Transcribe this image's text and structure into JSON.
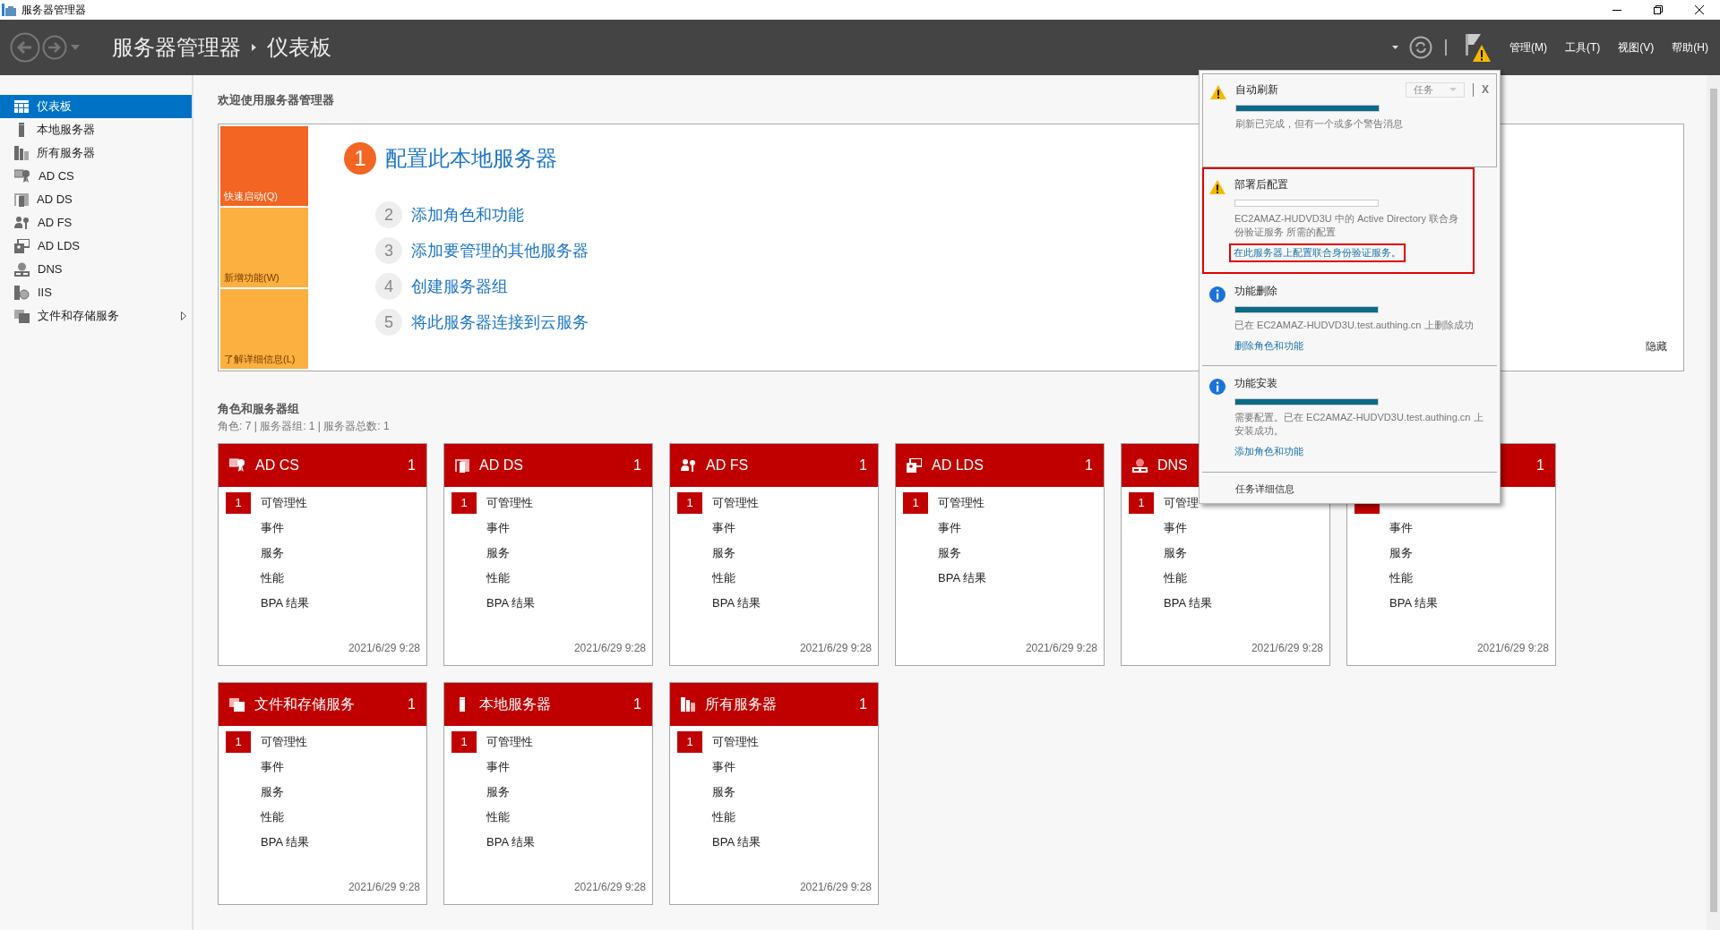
{
  "window": {
    "title": "服务器管理器"
  },
  "header": {
    "breadcrumb": [
      "服务器管理器",
      "仪表板"
    ],
    "menus": [
      "管理(M)",
      "工具(T)",
      "视图(V)",
      "帮助(H)"
    ],
    "flag_warning": true
  },
  "sidebar": {
    "items": [
      {
        "kind": "dashboard",
        "label": "仪表板",
        "selected": true,
        "has_children": false
      },
      {
        "kind": "local",
        "label": "本地服务器",
        "selected": false,
        "has_children": false
      },
      {
        "kind": "all",
        "label": "所有服务器",
        "selected": false,
        "has_children": false
      },
      {
        "kind": "adcs",
        "label": "AD CS",
        "selected": false,
        "has_children": false
      },
      {
        "kind": "adds",
        "label": "AD DS",
        "selected": false,
        "has_children": false
      },
      {
        "kind": "adfs",
        "label": "AD FS",
        "selected": false,
        "has_children": false
      },
      {
        "kind": "adlds",
        "label": "AD LDS",
        "selected": false,
        "has_children": false
      },
      {
        "kind": "dns",
        "label": "DNS",
        "selected": false,
        "has_children": false
      },
      {
        "kind": "iis",
        "label": "IIS",
        "selected": false,
        "has_children": false
      },
      {
        "kind": "files",
        "label": "文件和存储服务",
        "selected": false,
        "has_children": true
      }
    ]
  },
  "welcome": {
    "title": "欢迎使用服务器管理器",
    "quick_tiles": [
      {
        "label": "快速启动(Q)",
        "selected": true
      },
      {
        "label": "新增功能(W)",
        "selected": false
      },
      {
        "label": "了解详细信息(L)",
        "selected": false
      }
    ],
    "steps": [
      {
        "number": "1",
        "label": "配置此本地服务器",
        "primary": true
      },
      {
        "number": "2",
        "label": "添加角色和功能",
        "primary": false
      },
      {
        "number": "3",
        "label": "添加要管理的其他服务器",
        "primary": false
      },
      {
        "number": "4",
        "label": "创建服务器组",
        "primary": false
      },
      {
        "number": "5",
        "label": "将此服务器连接到云服务",
        "primary": false
      }
    ],
    "hide": "隐藏"
  },
  "roles": {
    "title": "角色和服务器组",
    "summary": "角色: 7 | 服务器组: 1 | 服务器总数: 1",
    "tiles": [
      {
        "kind": "adcs",
        "title": "AD CS",
        "count": "1",
        "rows": [
          {
            "label": "可管理性",
            "alert": true,
            "badge": "1"
          },
          {
            "label": "事件",
            "alert": false
          },
          {
            "label": "服务",
            "alert": false
          },
          {
            "label": "性能",
            "alert": false
          },
          {
            "label": "BPA 结果",
            "alert": false
          }
        ],
        "timestamp": "2021/6/29 9:28"
      },
      {
        "kind": "adds",
        "title": "AD DS",
        "count": "1",
        "rows": [
          {
            "label": "可管理性",
            "alert": true,
            "badge": "1"
          },
          {
            "label": "事件",
            "alert": false
          },
          {
            "label": "服务",
            "alert": false
          },
          {
            "label": "性能",
            "alert": false
          },
          {
            "label": "BPA 结果",
            "alert": false
          }
        ],
        "timestamp": "2021/6/29 9:28"
      },
      {
        "kind": "adfs",
        "title": "AD FS",
        "count": "1",
        "rows": [
          {
            "label": "可管理性",
            "alert": true,
            "badge": "1"
          },
          {
            "label": "事件",
            "alert": false
          },
          {
            "label": "服务",
            "alert": false
          },
          {
            "label": "性能",
            "alert": false
          },
          {
            "label": "BPA 结果",
            "alert": false
          }
        ],
        "timestamp": "2021/6/29 9:28"
      },
      {
        "kind": "adlds",
        "title": "AD LDS",
        "count": "1",
        "rows": [
          {
            "label": "可管理性",
            "alert": true,
            "badge": "1"
          },
          {
            "label": "事件",
            "alert": false
          },
          {
            "label": "服务",
            "alert": false
          },
          {
            "label": "BPA 结果",
            "alert": false
          }
        ],
        "timestamp": "2021/6/29 9:28"
      },
      {
        "kind": "dns",
        "title": "DNS",
        "rows": [
          {
            "label": "可管理",
            "alert": true,
            "badge": "1"
          },
          {
            "label": "事件",
            "alert": false
          },
          {
            "label": "服务",
            "alert": false
          },
          {
            "label": "性能",
            "alert": false
          },
          {
            "label": "BPA 结果",
            "alert": false
          }
        ],
        "timestamp": "2021/6/29 9:28"
      },
      {
        "kind": "hidden",
        "count": "1",
        "rows": [
          {
            "alert": true
          },
          {
            "label": "事件",
            "alert": false
          },
          {
            "label": "服务",
            "alert": false
          },
          {
            "label": "性能",
            "alert": false
          },
          {
            "label": "BPA 结果",
            "alert": false
          }
        ],
        "timestamp": "2021/6/29 9:28"
      },
      {
        "kind": "files",
        "title": "文件和存储服务",
        "count": "1",
        "rows": [
          {
            "label": "可管理性",
            "alert": true,
            "badge": "1"
          },
          {
            "label": "事件",
            "alert": false
          },
          {
            "label": "服务",
            "alert": false
          },
          {
            "label": "性能",
            "alert": false
          },
          {
            "label": "BPA 结果",
            "alert": false
          }
        ],
        "timestamp": "2021/6/29 9:28"
      },
      {
        "kind": "local",
        "title": "本地服务器",
        "count": "1",
        "rows": [
          {
            "label": "可管理性",
            "alert": true,
            "badge": "1"
          },
          {
            "label": "事件",
            "alert": false
          },
          {
            "label": "服务",
            "alert": false
          },
          {
            "label": "性能",
            "alert": false
          },
          {
            "label": "BPA 结果",
            "alert": false
          }
        ],
        "timestamp": "2021/6/29 9:28"
      },
      {
        "kind": "all",
        "title": "所有服务器",
        "count": "1",
        "rows": [
          {
            "label": "可管理性",
            "alert": true,
            "badge": "1"
          },
          {
            "label": "事件",
            "alert": false
          },
          {
            "label": "服务",
            "alert": false
          },
          {
            "label": "性能",
            "alert": false
          },
          {
            "label": "BPA 结果",
            "alert": false
          }
        ],
        "timestamp": "2021/6/29 9:28"
      }
    ]
  },
  "notifications": {
    "task_button": "任务",
    "close": "X",
    "items": [
      {
        "kind": "warning",
        "title": "自动刷新",
        "level": 1,
        "message": "刷新已完成，但有一个或多个警告消息",
        "selected": true,
        "highlighted": false
      },
      {
        "kind": "warning",
        "title": "部署后配置",
        "level": 0,
        "message": "EC2AMAZ-HUDVD3U 中的 Active Directory 联合身份验证服务 所需的配置",
        "link": "在此服务器上配置联合身份验证服务。",
        "link_highlighted": true,
        "selected": false,
        "highlighted": true
      },
      {
        "kind": "info",
        "title": "功能删除",
        "level": 1,
        "message": "已在 EC2AMAZ-HUDVD3U.test.authing.cn 上删除成功",
        "link": "删除角色和功能",
        "link_highlighted": false,
        "selected": false,
        "highlighted": false
      },
      {
        "kind": "info",
        "title": "功能安装",
        "level": 1,
        "message": "需要配置。已在 EC2AMAZ-HUDVD3U.test.authing.cn 上安装成功。",
        "link": "添加角色和功能",
        "link_highlighted": false,
        "selected": false,
        "highlighted": false
      }
    ],
    "footer": "任务详细信息"
  }
}
